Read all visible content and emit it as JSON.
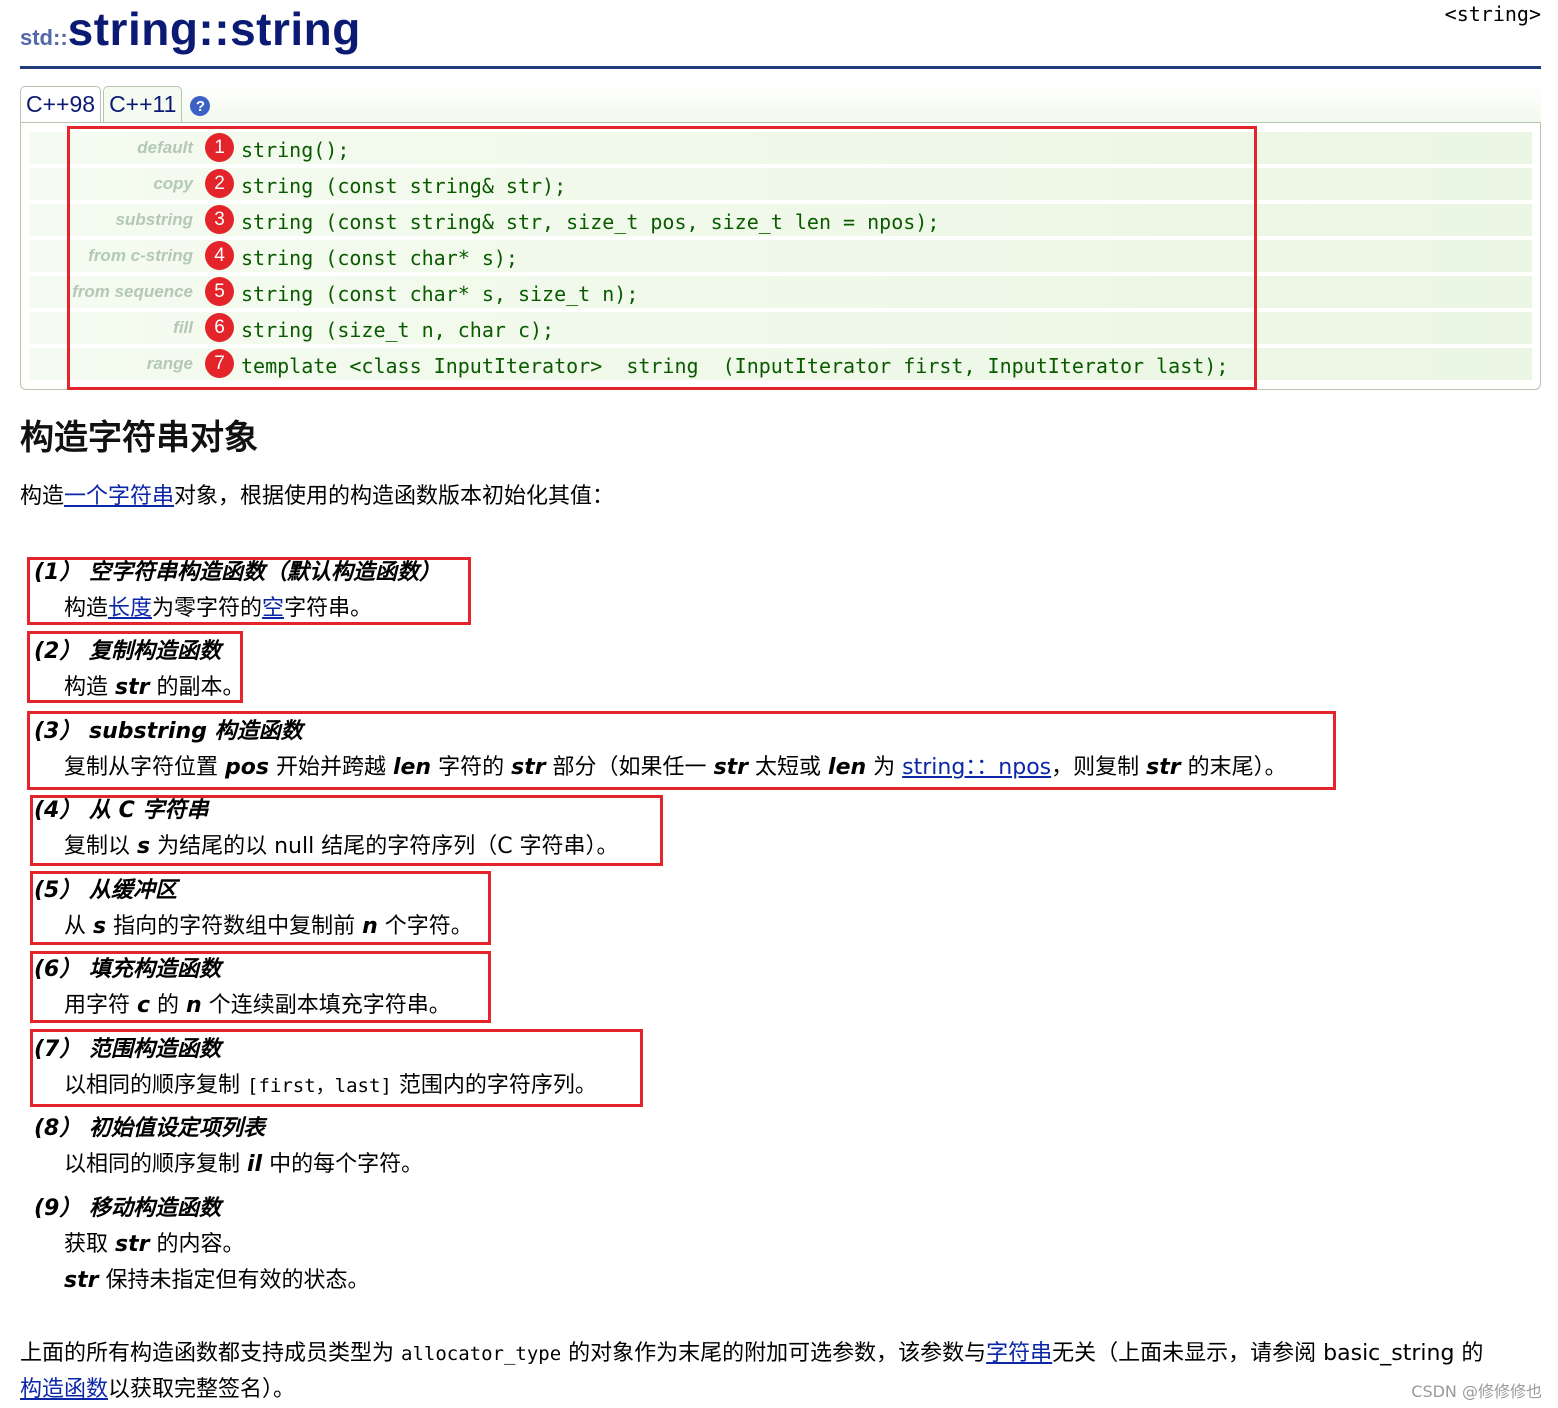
{
  "header": {
    "ns": "std::",
    "title": "string::string",
    "tag": "<string>"
  },
  "tabs": [
    {
      "label": "C++98"
    },
    {
      "label": "C++11"
    }
  ],
  "help_icon": "question-icon",
  "declarations": [
    {
      "label": "default",
      "num": "1",
      "code": "string();"
    },
    {
      "label": "copy",
      "num": "2",
      "code": "string (const string& str);"
    },
    {
      "label": "substring",
      "num": "3",
      "code": "string (const string& str, size_t pos, size_t len = npos);"
    },
    {
      "label": "from c-string",
      "num": "4",
      "code": "string (const char* s);"
    },
    {
      "label": "from sequence",
      "num": "5",
      "code": "string (const char* s, size_t n);"
    },
    {
      "label": "fill",
      "num": "6",
      "code": "string (size_t n, char c);"
    },
    {
      "label": "range",
      "num": "7",
      "code": "template <class InputIterator>  string  (InputIterator first, InputIterator last);"
    }
  ],
  "section_title": "构造字符串对象",
  "intro": {
    "pre": "构造",
    "link": "一个字符串",
    "post": "对象，根据使用的构造函数版本初始化其值："
  },
  "items": [
    {
      "title": "(1） 空字符串构造函数（默认构造函数）",
      "d1": "构造",
      "d_link1": "长度",
      "d2": "为零字符的",
      "d_link2": "空",
      "d3": "字符串。"
    },
    {
      "title": "(2） 复制构造函数",
      "d1": "构造 ",
      "d_b1": "str",
      "d2": " 的副本。"
    },
    {
      "title": "(3） substring 构造函数",
      "d1": "复制从字符位置 ",
      "d_b1": "pos",
      "d2": " 开始并跨越 ",
      "d_b2": "len",
      "d3": " 字符的 ",
      "d_b3": "str",
      "d4": " 部分（如果任一 ",
      "d_b4": "str",
      "d5": " 太短或 ",
      "d_b5": "len",
      "d6": " 为 ",
      "d_link": "string：：npos",
      "d7": "，则复制 ",
      "d_b6": "str",
      "d8": " 的末尾）。"
    },
    {
      "title": "(4） 从 C 字符串",
      "d1": "复制以 ",
      "d_b1": "s",
      "d2": " 为结尾的以 null 结尾的字符序列（C 字符串）。"
    },
    {
      "title": "(5） 从缓冲区",
      "d1": "从 ",
      "d_b1": "s",
      "d2": " 指向的字符数组中复制前 ",
      "d_b2": "n",
      "d3": " 个字符。"
    },
    {
      "title": "(6） 填充构造函数",
      "d1": "用字符 ",
      "d_b1": "c",
      "d2": " 的 ",
      "d_b2": "n",
      "d3": " 个连续副本填充字符串。"
    },
    {
      "title": "(7） 范围构造函数",
      "d1": "以相同的顺序复制 ",
      "d_mono": "[first，last]",
      "d2": " 范围内的字符序列。"
    },
    {
      "title": "(8） 初始值设定项列表",
      "d1": "以相同的顺序复制 ",
      "d_b1": "il",
      "d2": " 中的每个字符。"
    },
    {
      "title": "(9） 移动构造函数",
      "d1": "获取 ",
      "d_b1": "str",
      "d2": " 的内容。",
      "e_b1": "str",
      "e2": " 保持未指定但有效的状态。"
    }
  ],
  "footer": {
    "t1": "上面的所有构造函数都支持成员类型为 ",
    "mono": "allocator_type",
    "t2": " 的对象作为末尾的附加可选参数，该参数与",
    "link1": "字符串",
    "t3": "无关（上面未显示，请参阅 basic_string 的",
    "link2": "构造函数",
    "t4": "以获取完整签名）。"
  },
  "watermark": "CSDN @修修修也",
  "colors": {
    "accent": "#e3242b",
    "title": "#0b1a73",
    "code": "#0a5a00",
    "link": "#0b27a8"
  }
}
